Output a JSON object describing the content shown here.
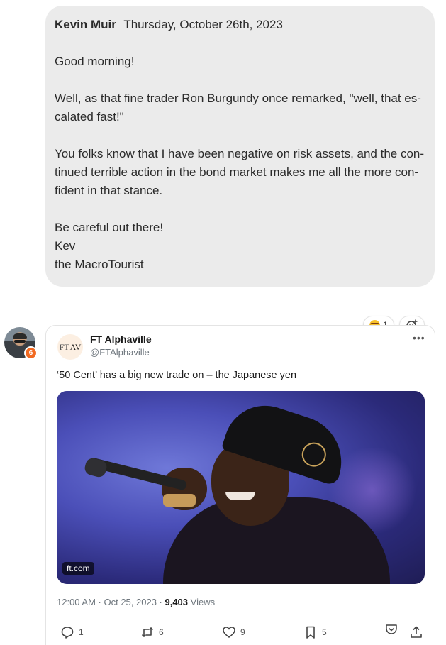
{
  "message": {
    "author": "Kevin Muir",
    "date": "Thursday, October 26th, 2023",
    "greeting": "Good morning!",
    "para1_line1": "Well, as that fine trader Ron Burgundy once remarked, \"well, that es-",
    "para1_line2": "calated fast!\"",
    "para2_line1": "You folks know that I have been negative on risk assets, and the con-",
    "para2_line2": "tinued terrible action in the bond market makes me all the more con-",
    "para2_line3": "fident in that stance.",
    "signoff_line1": "Be careful out there!",
    "signoff_line2": "Kev",
    "signoff_line3": "the MacroTourist"
  },
  "poster": {
    "badge_count": "6"
  },
  "reactions": {
    "laugh_count": "1"
  },
  "tweet": {
    "logo_text_1": "FT",
    "logo_text_2": "AV",
    "account_name": "FT Alphaville",
    "handle": "@FTAlphaville",
    "text": "‘50 Cent’ has a big new trade on – the Japanese yen",
    "image_source": "ft.com",
    "time": "12:00 AM · Oct 25, 2023 · ",
    "views_count": "9,403",
    "views_label": " Views",
    "replies": "1",
    "retweets": "6",
    "likes": "9",
    "bookmarks": "5"
  }
}
